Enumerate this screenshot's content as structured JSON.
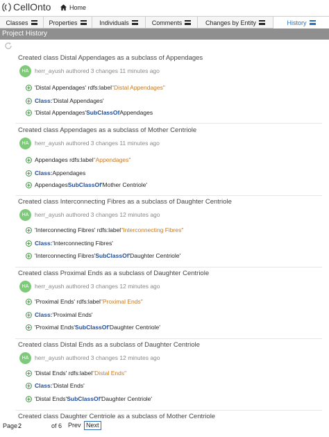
{
  "app": {
    "title": "CellOnto",
    "home_label": "Home"
  },
  "tabs": [
    {
      "label": "Classes",
      "active": false
    },
    {
      "label": "Properties",
      "active": false
    },
    {
      "label": "Individuals",
      "active": false
    },
    {
      "label": "Comments",
      "active": false
    },
    {
      "label": "Changes by Entity",
      "active": false
    },
    {
      "label": "History",
      "active": true
    }
  ],
  "panel": {
    "title": "Project History"
  },
  "entries": [
    {
      "title": "Created class Distal Appendages as a subclass of Appendages",
      "avatar": "HA",
      "author": "herr_ayush authored 3 changes 11 minutes ago",
      "changes": [
        {
          "subject": "'Distal Appendages' rdfs:label ",
          "keyword": "",
          "object": "\"Distal Appendages\""
        },
        {
          "subject": "",
          "keyword": "Class:",
          "object": " 'Distal Appendages'"
        },
        {
          "subject": "'Distal Appendages' ",
          "keyword": "SubClassOf",
          "object": " Appendages"
        }
      ]
    },
    {
      "title": "Created class Appendages as a subclass of Mother Centriole",
      "avatar": "HA",
      "author": "herr_ayush authored 3 changes 11 minutes ago",
      "changes": [
        {
          "subject": "Appendages rdfs:label ",
          "keyword": "",
          "object": "\"Appendages\""
        },
        {
          "subject": "",
          "keyword": "Class:",
          "object": " Appendages"
        },
        {
          "subject": "Appendages ",
          "keyword": "SubClassOf",
          "object": " 'Mother Centriole'"
        }
      ]
    },
    {
      "title": "Created class Interconnecting Fibres as a subclass of Daughter Centriole",
      "avatar": "HA",
      "author": "herr_ayush authored 3 changes 12 minutes ago",
      "changes": [
        {
          "subject": "'Interconnecting Fibres' rdfs:label ",
          "keyword": "",
          "object": "\"Interconnecting Fibres\""
        },
        {
          "subject": "",
          "keyword": "Class:",
          "object": " 'Interconnecting Fibres'"
        },
        {
          "subject": "'Interconnecting Fibres' ",
          "keyword": "SubClassOf",
          "object": " 'Daughter Centriole'"
        }
      ]
    },
    {
      "title": "Created class Proximal Ends as a subclass of Daughter Centriole",
      "avatar": "HA",
      "author": "herr_ayush authored 3 changes 12 minutes ago",
      "changes": [
        {
          "subject": "'Proximal Ends' rdfs:label ",
          "keyword": "",
          "object": "\"Proximal Ends\""
        },
        {
          "subject": "",
          "keyword": "Class:",
          "object": " 'Proximal Ends'"
        },
        {
          "subject": "'Proximal Ends' ",
          "keyword": "SubClassOf",
          "object": " 'Daughter Centriole'"
        }
      ]
    },
    {
      "title": "Created class Distal Ends as a subclass of Daughter Centriole",
      "avatar": "HA",
      "author": "herr_ayush authored 3 changes 12 minutes ago",
      "changes": [
        {
          "subject": "'Distal Ends' rdfs:label ",
          "keyword": "",
          "object": "\"Distal Ends\""
        },
        {
          "subject": "",
          "keyword": "Class:",
          "object": " 'Distal Ends'"
        },
        {
          "subject": "'Distal Ends' ",
          "keyword": "SubClassOf",
          "object": " 'Daughter Centriole'"
        }
      ]
    },
    {
      "title": "Created class Daughter Centriole as a subclass of Mother Centriole",
      "avatar": "",
      "author": "",
      "changes": []
    }
  ],
  "pagination": {
    "page_label": "Page",
    "current_page": "2",
    "of_label": "of 6",
    "prev_label": "Prev",
    "next_label": "Next"
  },
  "colors": {
    "header_bg": "#8f8f8f",
    "accent": "#2a6ebb",
    "avatar_bg": "#7ec97a",
    "keyword": "#1f4d9c",
    "literal": "#c8781e",
    "add_icon": "#3a9a3a"
  }
}
